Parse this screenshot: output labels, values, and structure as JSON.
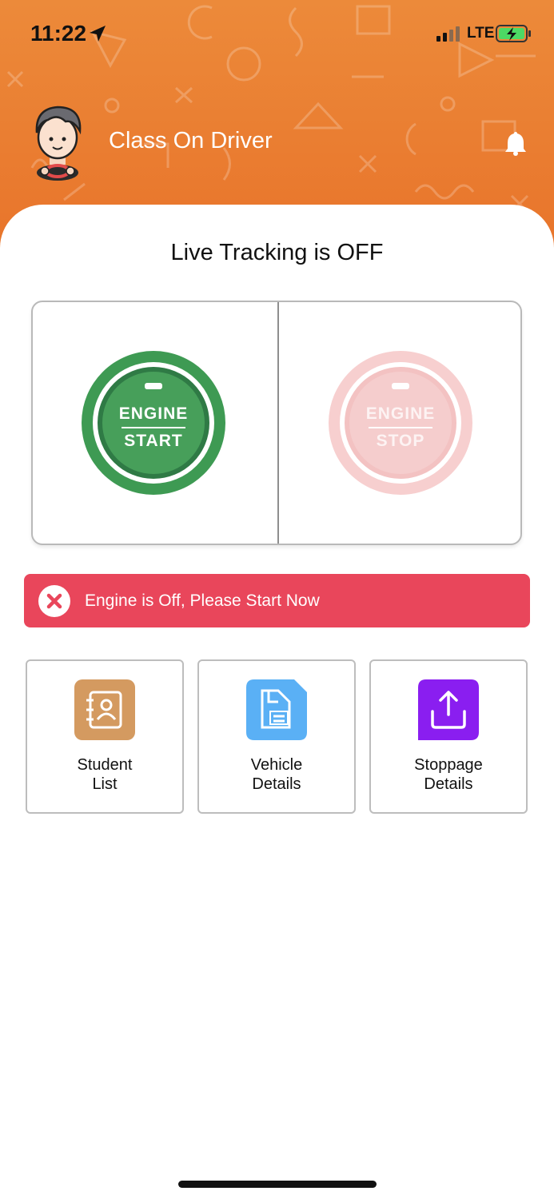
{
  "status_bar": {
    "time": "11:22",
    "network": "LTE",
    "icons": [
      "location-arrow-icon",
      "signal-icon",
      "battery-charging-icon"
    ]
  },
  "header": {
    "title": "Class On Driver",
    "avatar_icon": "driver-avatar-icon",
    "bell_icon": "bell-icon",
    "background_color": "#e8772c"
  },
  "tracking": {
    "status": "Live Tracking is OFF"
  },
  "engine": {
    "start": {
      "line1": "ENGINE",
      "line2": "START",
      "color": "#3e9a53"
    },
    "stop": {
      "line1": "ENGINE",
      "line2": "STOP",
      "color": "#f5c9c9"
    }
  },
  "alert": {
    "message": "Engine is Off, Please Start Now",
    "icon": "close-circle-icon",
    "color": "#e9465b"
  },
  "menu": [
    {
      "line1": "Student",
      "line2": "List",
      "icon": "contacts-book-icon",
      "color": "#d49a60"
    },
    {
      "line1": "Vehicle",
      "line2": "Details",
      "icon": "document-folder-icon",
      "color": "#5ab0f5"
    },
    {
      "line1": "Stoppage",
      "line2": "Details",
      "icon": "upload-icon",
      "color": "#8a1ef0"
    }
  ]
}
